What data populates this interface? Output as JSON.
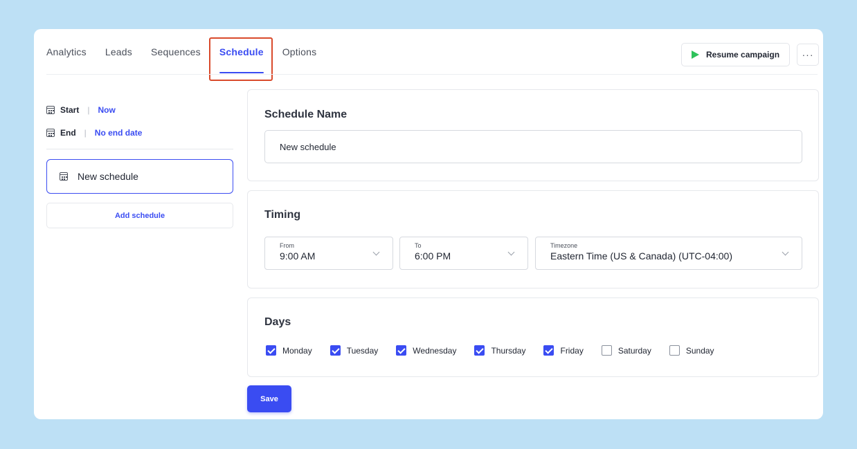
{
  "nav": {
    "tabs": [
      {
        "label": "Analytics",
        "active": false
      },
      {
        "label": "Leads",
        "active": false
      },
      {
        "label": "Sequences",
        "active": false
      },
      {
        "label": "Schedule",
        "active": true
      },
      {
        "label": "Options",
        "active": false
      }
    ],
    "resume_label": "Resume campaign",
    "more_label": "···"
  },
  "sidebar": {
    "start_key": "Start",
    "start_value": "Now",
    "end_key": "End",
    "end_value": "No end date",
    "separator": "|",
    "schedule_item": "New schedule",
    "add_schedule": "Add schedule"
  },
  "schedule_name": {
    "title": "Schedule Name",
    "value": "New schedule"
  },
  "timing": {
    "title": "Timing",
    "from_label": "From",
    "from_value": "9:00 AM",
    "to_label": "To",
    "to_value": "6:00 PM",
    "timezone_label": "Timezone",
    "timezone_value": "Eastern Time (US & Canada) (UTC-04:00)"
  },
  "days": {
    "title": "Days",
    "items": [
      {
        "label": "Monday",
        "checked": true
      },
      {
        "label": "Tuesday",
        "checked": true
      },
      {
        "label": "Wednesday",
        "checked": true
      },
      {
        "label": "Thursday",
        "checked": true
      },
      {
        "label": "Friday",
        "checked": true
      },
      {
        "label": "Saturday",
        "checked": false
      },
      {
        "label": "Sunday",
        "checked": false
      }
    ]
  },
  "save_label": "Save",
  "colors": {
    "accent": "#3a4cf2",
    "background": "#bde0f5",
    "highlight": "#d94a2b",
    "play": "#2fc25b"
  }
}
